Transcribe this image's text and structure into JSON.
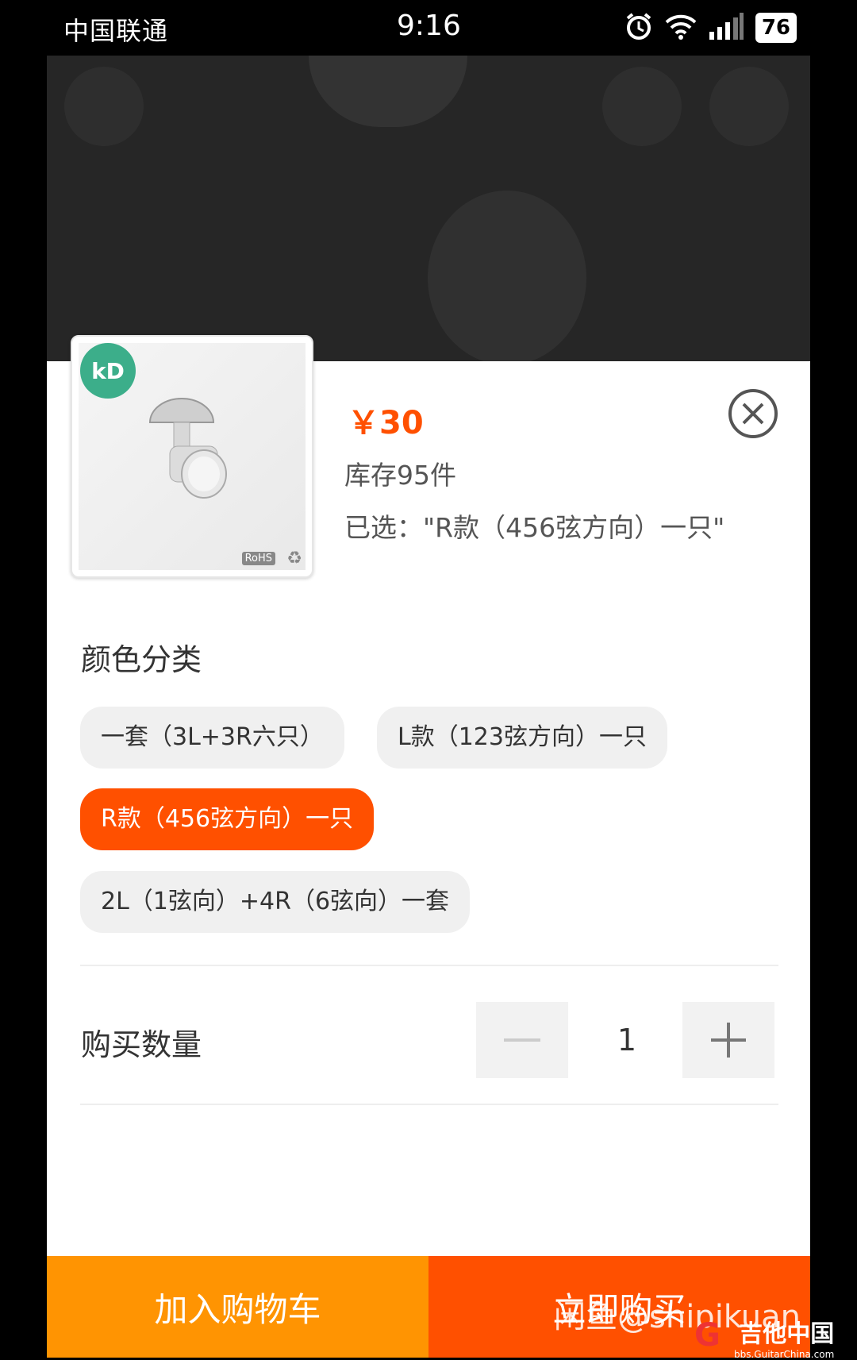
{
  "status_bar": {
    "carrier": "中国联通",
    "time": "9:16",
    "battery": "76"
  },
  "product": {
    "logo_text": "kD",
    "rohs_label": "RoHS",
    "price": "￥30",
    "stock": "库存95件",
    "selected": "已选：\"R款（456弦方向）一只\""
  },
  "color_section": {
    "title": "颜色分类",
    "options": [
      "一套（3L+3R六只）",
      "L款（123弦方向）一只",
      "R款（456弦方向）一只",
      "2L（1弦向）+4R（6弦向）一套"
    ],
    "selected_index": 2
  },
  "quantity": {
    "label": "购买数量",
    "value": "1"
  },
  "actions": {
    "add_to_cart": "加入购物车",
    "buy_now": "立即购买"
  },
  "watermark": "闲鱼@shipikuan",
  "site_logo": {
    "main": "吉他中国",
    "url": "bbs.GuitarChina.com"
  },
  "colors": {
    "accent": "#ff5000",
    "cart": "#ff9402"
  }
}
